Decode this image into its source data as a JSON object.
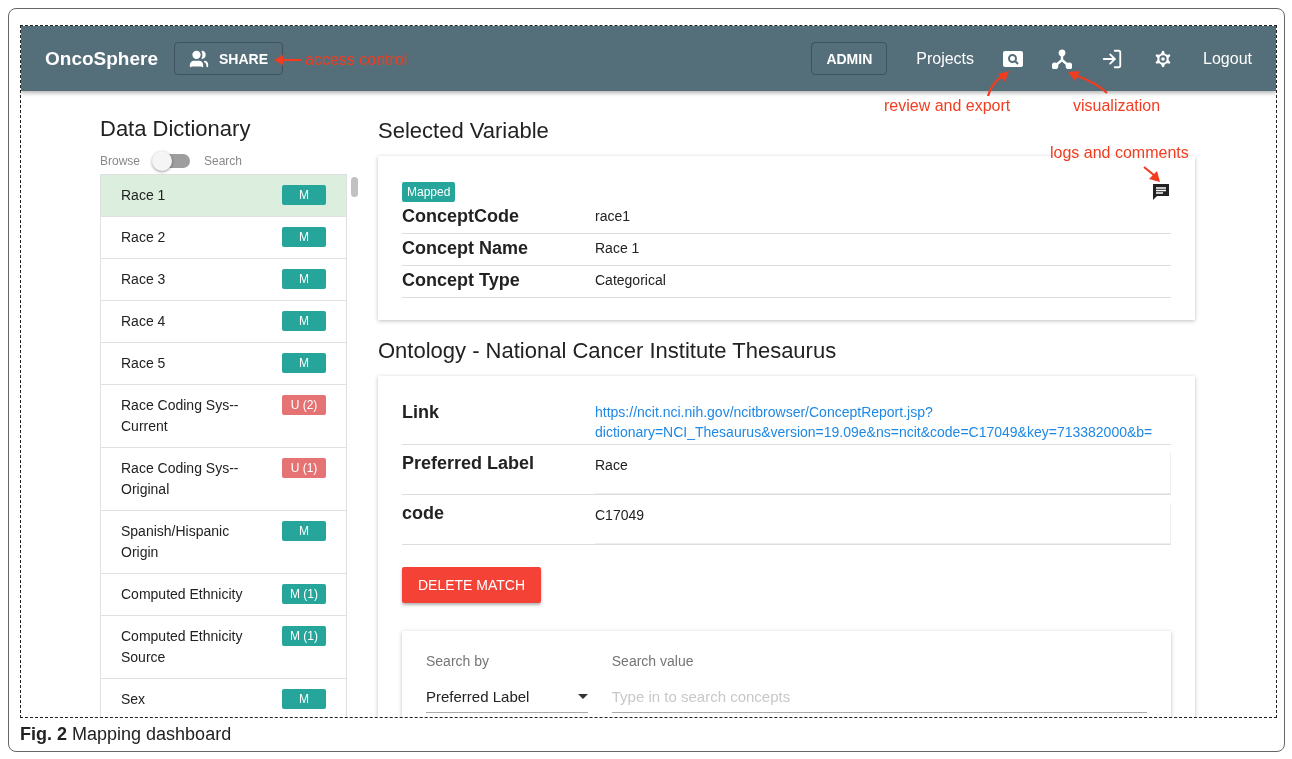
{
  "navbar": {
    "brand": "OncoSphere",
    "share_button": "SHARE",
    "admin_button": "ADMIN",
    "projects_link": "Projects",
    "logout_link": "Logout"
  },
  "annotations": [
    {
      "text": "access control"
    },
    {
      "text": "review and export"
    },
    {
      "text": "visualization"
    },
    {
      "text": "logs and comments"
    }
  ],
  "sidebar": {
    "title": "Data Dictionary",
    "toggle": {
      "left_label": "Browse",
      "right_label": "Search",
      "on": false
    },
    "items": [
      {
        "label": "Race 1",
        "badge": "M",
        "color": "#26a69a",
        "selected": true
      },
      {
        "label": "Race 2",
        "badge": "M",
        "color": "#26a69a",
        "selected": false
      },
      {
        "label": "Race 3",
        "badge": "M",
        "color": "#26a69a",
        "selected": false
      },
      {
        "label": "Race 4",
        "badge": "M",
        "color": "#26a69a",
        "selected": false
      },
      {
        "label": "Race 5",
        "badge": "M",
        "color": "#26a69a",
        "selected": false
      },
      {
        "label": "Race Coding Sys--Current",
        "badge": "U (2)",
        "color": "#e57373",
        "selected": false
      },
      {
        "label": "Race Coding Sys--Original",
        "badge": "U (1)",
        "color": "#e57373",
        "selected": false
      },
      {
        "label": "Spanish/Hispanic Origin",
        "badge": "M",
        "color": "#26a69a",
        "selected": false
      },
      {
        "label": "Computed Ethnicity",
        "badge": "M (1)",
        "color": "#26a69a",
        "selected": false
      },
      {
        "label": "Computed Ethnicity Source",
        "badge": "M (1)",
        "color": "#26a69a",
        "selected": false
      },
      {
        "label": "Sex",
        "badge": "M",
        "color": "#26a69a",
        "selected": false
      }
    ]
  },
  "selected_variable": {
    "title": "Selected Variable",
    "status_tag": "Mapped",
    "fields": [
      {
        "label": "ConceptCode",
        "value": "race1"
      },
      {
        "label": "Concept Name",
        "value": "Race 1"
      },
      {
        "label": "Concept Type",
        "value": "Categorical"
      }
    ]
  },
  "ontology": {
    "title": "Ontology - National Cancer Institute Thesaurus",
    "fields": [
      {
        "label": "Link",
        "value": "https://ncit.nci.nih.gov/ncitbrowser/ConceptReport.jsp?dictionary=NCI_Thesaurus&version=19.09e&ns=ncit&code=C17049&key=713382000&b=",
        "kind": "link"
      },
      {
        "label": "Preferred Label",
        "value": "Race",
        "kind": "box"
      },
      {
        "label": "code",
        "value": "C17049",
        "kind": "box"
      }
    ],
    "delete_button": "DELETE MATCH",
    "search": {
      "search_by": {
        "label": "Search by",
        "value": "Preferred Label"
      },
      "search_value": {
        "label": "Search value",
        "placeholder": "Type in to search concepts"
      }
    }
  },
  "caption": {
    "label": "Fig. 2",
    "text": "Mapping dashboard"
  }
}
